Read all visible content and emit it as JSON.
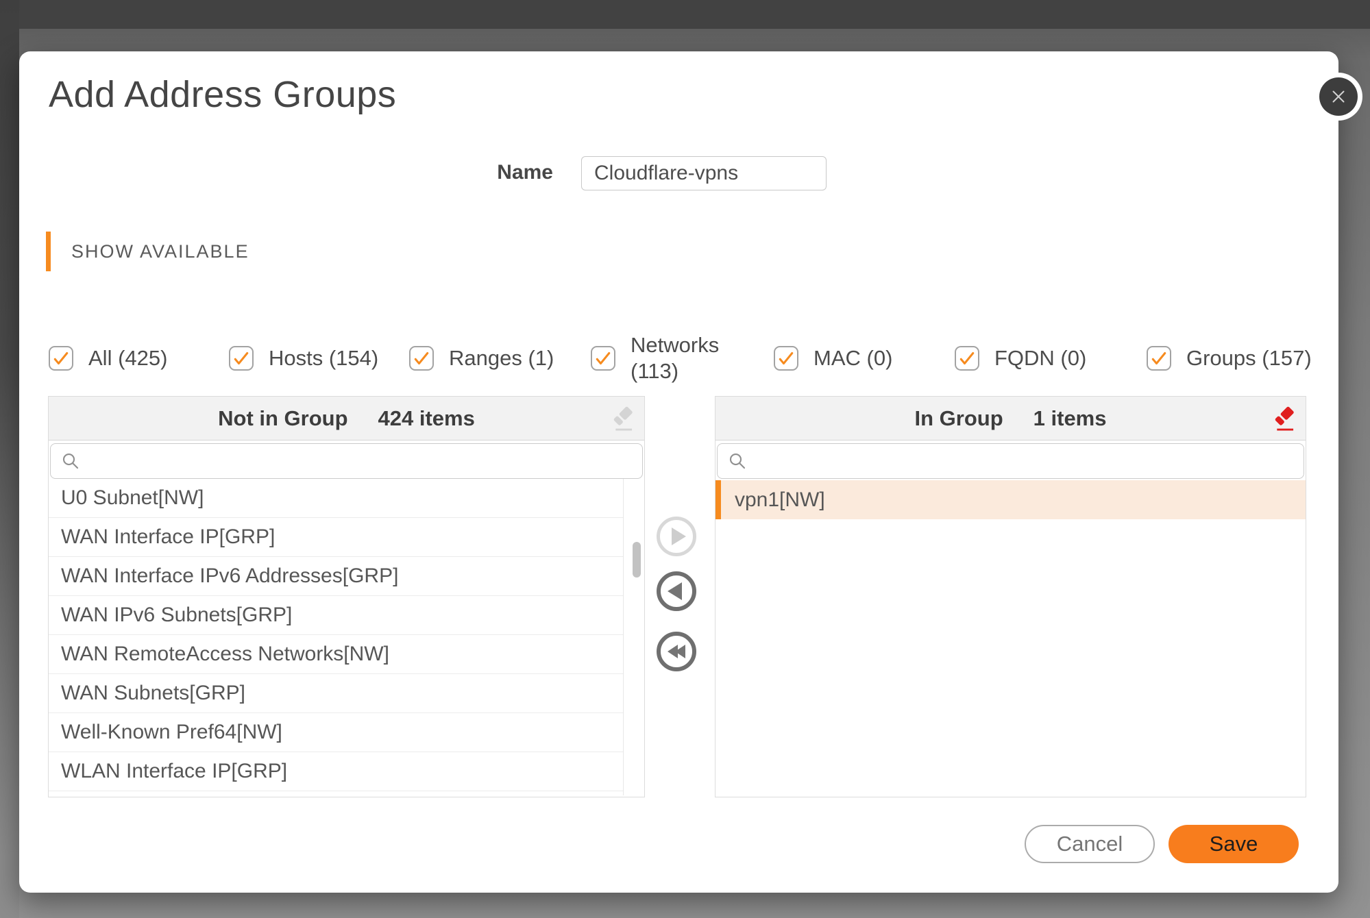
{
  "dialog": {
    "title": "Add Address Groups"
  },
  "form": {
    "name_label": "Name",
    "name_value": "Cloudflare-vpns"
  },
  "section": {
    "label": "SHOW AVAILABLE"
  },
  "filters": {
    "items": [
      {
        "label": "All (425)",
        "checked": true
      },
      {
        "label": "Hosts (154)",
        "checked": true
      },
      {
        "label": "Ranges (1)",
        "checked": true
      },
      {
        "label": "Networks (113)",
        "checked": true
      },
      {
        "label": "MAC (0)",
        "checked": true
      },
      {
        "label": "FQDN (0)",
        "checked": true
      },
      {
        "label": "Groups (157)",
        "checked": true
      }
    ]
  },
  "left_panel": {
    "title": "Not in Group",
    "count": "424 items",
    "items": [
      "U0 Subnet[NW]",
      "WAN Interface IP[GRP]",
      "WAN Interface IPv6 Addresses[GRP]",
      "WAN IPv6 Subnets[GRP]",
      "WAN RemoteAccess Networks[NW]",
      "WAN Subnets[GRP]",
      "Well-Known Pref64[NW]",
      "WLAN Interface IP[GRP]"
    ]
  },
  "right_panel": {
    "title": "In Group",
    "count": "1 items",
    "items": [
      "vpn1[NW]"
    ]
  },
  "actions": {
    "cancel": "Cancel",
    "save": "Save"
  },
  "icons": {
    "close": "x-cross",
    "search": "magnifier",
    "checkbox": "orange-check",
    "clear_left": "gray-eraser",
    "clear_right": "red-eraser",
    "move_right": "triangle-right",
    "move_left": "triangle-left",
    "move_all_left": "double-triangle-left"
  },
  "colors": {
    "accent_orange": "#F68B1F",
    "save_button": "#F87D1D",
    "eraser_red": "#E02020",
    "selected_row_bg": "#FBEADC",
    "panel_header_bg": "#F2F2F2"
  }
}
